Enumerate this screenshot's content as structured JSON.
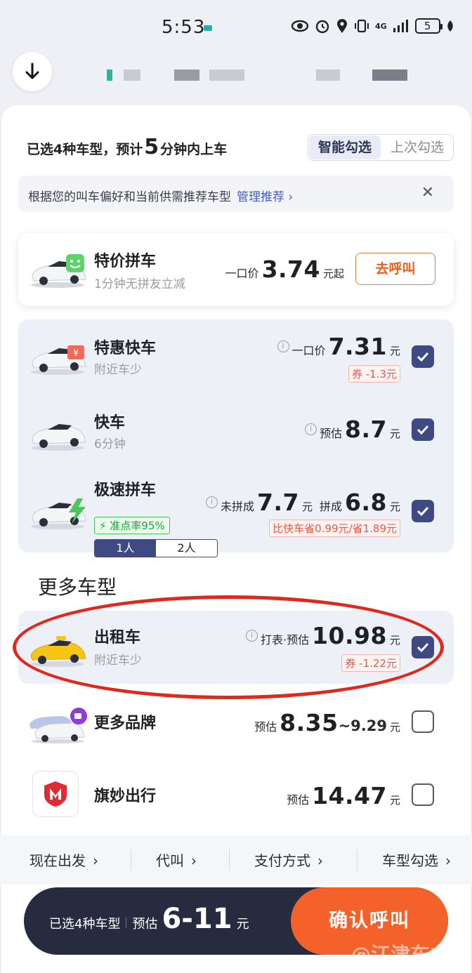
{
  "status_bar": {
    "time": "5:53",
    "network": "4G",
    "battery": "5"
  },
  "summary": {
    "prefix": "已选4种车型，预计",
    "minutes": "5",
    "suffix": "分钟内上车"
  },
  "select_mode": {
    "smart": "智能勾选",
    "last": "上次勾选"
  },
  "tip": {
    "text": "根据您的叫车偏好和当前供需推荐车型",
    "link": "管理推荐 ›",
    "close": "✕"
  },
  "special": {
    "name": "特价拼车",
    "sub": "1分钟无拼友立减",
    "price_label": "一口价",
    "price": "3.74",
    "price_unit": "元起",
    "button": "去呼叫"
  },
  "options": [
    {
      "name": "特惠快车",
      "sub": "附近车少",
      "price_label": "一口价",
      "price": "7.31",
      "unit": "元",
      "coupon": "券 -1.3元",
      "checked": true
    },
    {
      "name": "快车",
      "sub": "6分钟",
      "price_label": "预估",
      "price": "8.7",
      "unit": "元",
      "checked": true
    },
    {
      "name": "极速拼车",
      "tag": "⚡ 准点率95%",
      "pax": [
        "1人",
        "2人"
      ],
      "price_label_a": "未拼成",
      "price_a": "7.7",
      "price_label_b": "拼成",
      "price_b": "6.8",
      "unit": "元",
      "saving": "比快车省0.99元/省1.89元",
      "checked": true
    }
  ],
  "more": {
    "title": "更多车型",
    "taxi": {
      "name": "出租车",
      "sub": "附近车少",
      "price_label": "打表·预估",
      "price": "10.98",
      "unit": "元",
      "coupon": "券 -1.22元",
      "checked": true
    },
    "brands": {
      "name": "更多品牌",
      "price_label": "预估",
      "price": "8.35",
      "price_tail": "~9.29",
      "unit": "元",
      "checked": false
    },
    "qimiao": {
      "name": "旗妙出行",
      "price_label": "预估",
      "price": "14.47",
      "unit": "元",
      "checked": false
    }
  },
  "bottom_links": [
    "现在出发",
    "代叫",
    "支付方式",
    "车型勾选"
  ],
  "confirm": {
    "selected": "已选4种车型",
    "estimate_label": "预估",
    "range": "6-11",
    "unit": "元",
    "button": "确认呼叫"
  },
  "watermark": "@江津车主"
}
